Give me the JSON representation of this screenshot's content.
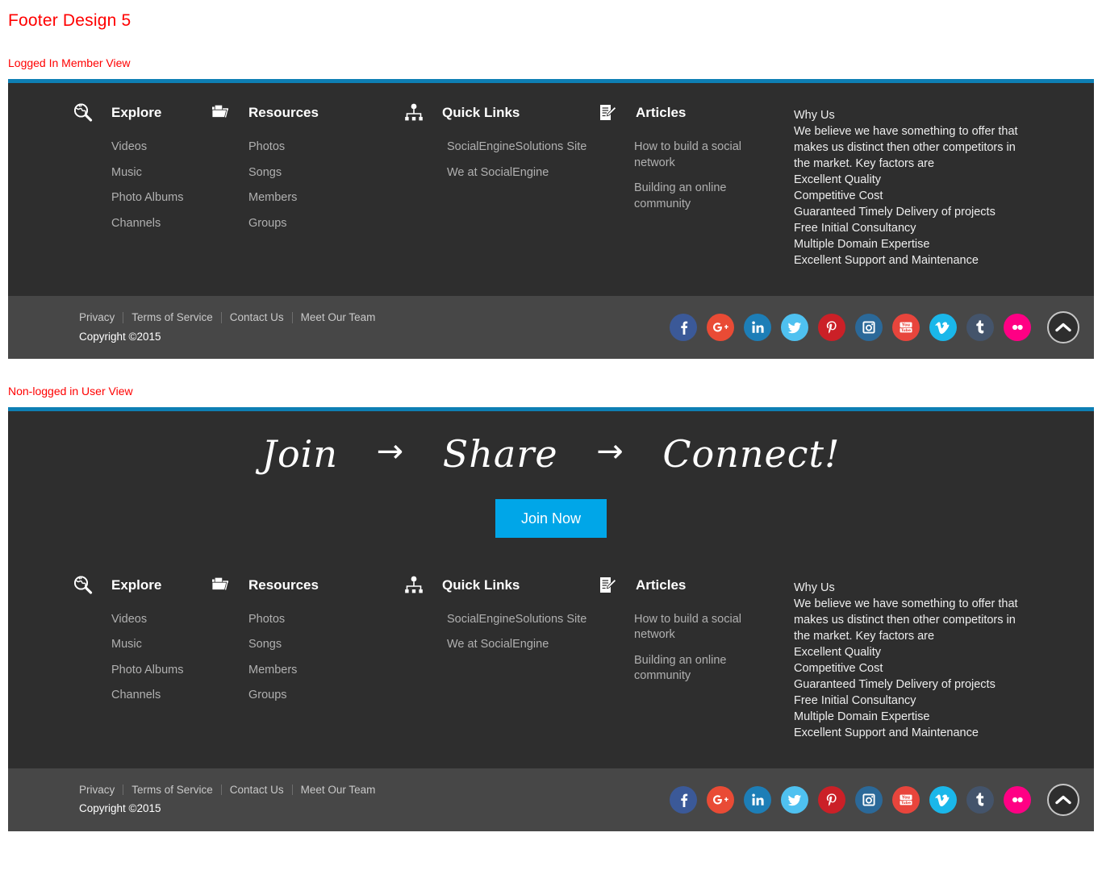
{
  "page": {
    "title": "Footer Design 5",
    "section_logged_in": "Logged In Member View",
    "section_non_logged": "Non-logged in User View",
    "accent_border": "#0e7fb4",
    "heading_color": "#ff0000",
    "footer_bg": "#2e2e2e",
    "footer_bottom_bg": "#474747",
    "link_color": "#b0b0b0",
    "button_color": "#00a6e8"
  },
  "promo": {
    "word1": "Join",
    "arrow1": "→",
    "word2": "Share",
    "arrow2": "→",
    "word3": "Connect!",
    "join_button": "Join Now"
  },
  "columns": [
    {
      "icon": "globe-search-icon",
      "title": "Explore",
      "links": [
        "Videos",
        "Music",
        "Photo Albums",
        "Channels"
      ]
    },
    {
      "icon": "folder-icon",
      "title": "Resources",
      "links": [
        "Photos",
        "Songs",
        "Members",
        "Groups"
      ]
    },
    {
      "icon": "sitemap-icon",
      "title": "Quick Links",
      "links": [
        "SocialEngineSolutions Site",
        "We at SocialEngine"
      ]
    },
    {
      "icon": "document-pen-icon",
      "title": "Articles",
      "links": [
        "How to build a social network",
        "Building an online community"
      ]
    }
  ],
  "whyus": {
    "text": "Why Us\nWe believe we have something to offer that makes us distinct then other competitors in\nthe market. Key factors are\nExcellent Quality\nCompetitive Cost\nGuaranteed Timely Delivery of projects\nFree Initial Consultancy\nMultiple Domain Expertise\nExcellent Support and Maintenance"
  },
  "bottom": {
    "links": [
      "Privacy",
      "Terms of Service",
      "Contact Us",
      "Meet Our Team"
    ],
    "copyright": "Copyright ©2015",
    "social": [
      {
        "name": "facebook",
        "label": "f",
        "color": "#3b5998"
      },
      {
        "name": "google-plus",
        "label": "g+",
        "color": "#e94b35"
      },
      {
        "name": "linkedin",
        "label": "in",
        "color": "#1d7eb7"
      },
      {
        "name": "twitter",
        "label": "t",
        "color": "#4fc1f0"
      },
      {
        "name": "pinterest",
        "label": "p",
        "color": "#cb2027"
      },
      {
        "name": "instagram",
        "label": "ig",
        "color": "#2b6999"
      },
      {
        "name": "youtube",
        "label": "yt",
        "color": "#e8453c"
      },
      {
        "name": "vimeo",
        "label": "v",
        "color": "#1ab7ea"
      },
      {
        "name": "tumblr",
        "label": "t",
        "color": "#44546b"
      },
      {
        "name": "flickr",
        "label": "fl",
        "color": "#ff0084"
      }
    ],
    "to_top": "back-to-top"
  }
}
